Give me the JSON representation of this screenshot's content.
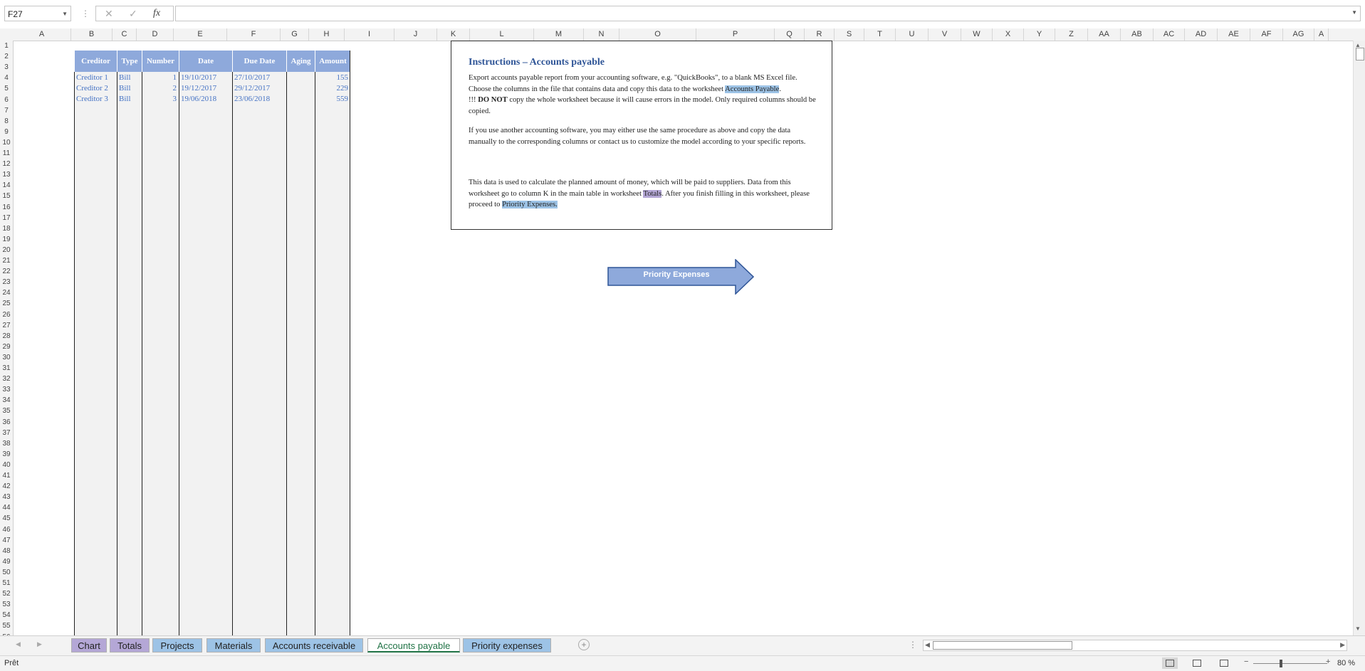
{
  "formula_bar": {
    "name_box": "F27",
    "cancel_glyph": "✕",
    "enter_glyph": "✓",
    "fx_label": "fx",
    "formula": ""
  },
  "columns": [
    "A",
    "B",
    "C",
    "D",
    "E",
    "F",
    "G",
    "H",
    "I",
    "J",
    "K",
    "L",
    "M",
    "N",
    "O",
    "P",
    "Q",
    "R",
    "S",
    "T",
    "U",
    "V",
    "W",
    "X",
    "Y",
    "Z",
    "AA",
    "AB",
    "AC",
    "AD",
    "AE",
    "AF",
    "AG",
    "A"
  ],
  "rows": [
    "1",
    "2",
    "3",
    "4",
    "5",
    "6",
    "7",
    "8",
    "9",
    "10",
    "11",
    "12",
    "13",
    "14",
    "15",
    "16",
    "17",
    "18",
    "19",
    "20",
    "21",
    "22",
    "23",
    "24",
    "25",
    "26",
    "27",
    "28",
    "29",
    "30",
    "31",
    "32",
    "33",
    "34",
    "35",
    "36",
    "37",
    "38",
    "39",
    "40",
    "41",
    "42",
    "43",
    "44",
    "45",
    "46",
    "47",
    "48",
    "49",
    "50",
    "51",
    "52",
    "53",
    "54",
    "55",
    "56"
  ],
  "table": {
    "headers": [
      "Creditor",
      "Type",
      "Number",
      "Date",
      "Due Date",
      "Aging",
      "Amount"
    ],
    "rows": [
      [
        "Creditor 1",
        "Bill",
        "1",
        "19/10/2017",
        "27/10/2017",
        "",
        "155"
      ],
      [
        "Creditor 2",
        "Bill",
        "2",
        "19/12/2017",
        "29/12/2017",
        "",
        "229"
      ],
      [
        "Creditor 3",
        "Bill",
        "3",
        "19/06/2018",
        "23/06/2018",
        "",
        "559"
      ]
    ]
  },
  "instructions": {
    "title": "Instructions – Accounts payable",
    "p1_a": "Export accounts payable report from your accounting software, e.g. \"QuickBooks\", to a blank MS Excel file. Choose the columns in the file that contains data and copy this data to the worksheet ",
    "p1_link": "Accounts Payable",
    "p1_b": ".",
    "p2_prefix": "!!! ",
    "p2_bold": "DO NOT",
    "p2_rest": " copy the whole worksheet because it will cause errors in the model. Only required columns should be copied.",
    "p3": "If you use another accounting software, you may either use the same procedure as above and copy the data manually to the corresponding columns or contact us to customize the model according to your specific reports.",
    "p4_a": "This data is used to calculate the planned amount of money, which will be paid to suppliers. Data from this worksheet go to column K in the main table in worksheet ",
    "p4_link1": "Totals",
    "p4_b": ". After you finish filling in this worksheet, please proceed to ",
    "p4_link2": "Priority Expenses."
  },
  "arrow_button": {
    "label": "Priority Expenses"
  },
  "sheet_tabs": [
    {
      "label": "Chart",
      "color": "#b4a7d6"
    },
    {
      "label": "Totals",
      "color": "#b4a7d6"
    },
    {
      "label": "Projects",
      "color": "#9dc3e6"
    },
    {
      "label": "Materials",
      "color": "#9dc3e6"
    },
    {
      "label": "Accounts receivable",
      "color": "#9dc3e6"
    },
    {
      "label": "Accounts payable",
      "color": "#ffffff",
      "active": true
    },
    {
      "label": "Priority expenses",
      "color": "#9dc3e6"
    }
  ],
  "tab_nav": {
    "prev": "◀",
    "next": "▶",
    "more": "⋮",
    "add": "+"
  },
  "status_bar": {
    "ready": "Prêt",
    "zoom": "80 %",
    "zoom_out": "−",
    "zoom_in": "+"
  },
  "colors": {
    "header_blue": "#8ea9db",
    "data_blue": "#4472c4",
    "title_blue": "#2f5597",
    "active_tab": "#217346"
  }
}
